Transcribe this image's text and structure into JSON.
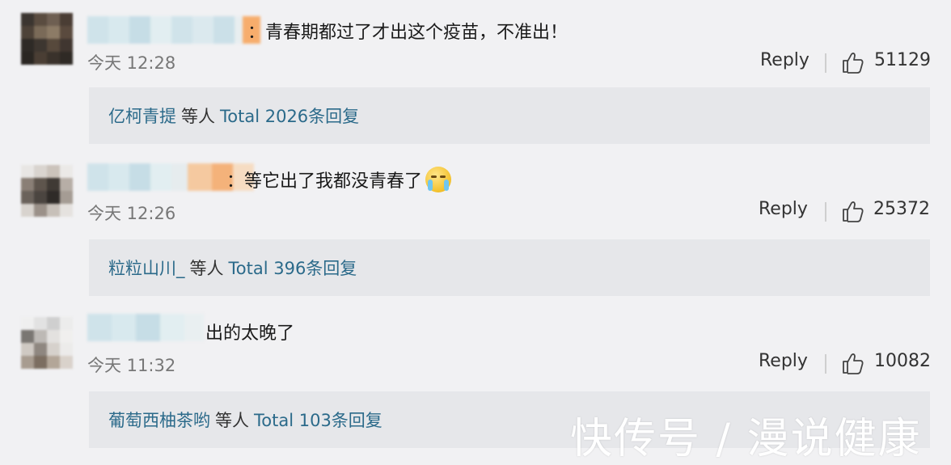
{
  "comments": [
    {
      "text": "：青春期都过了才出这个疫苗，不准出！",
      "time": "今天 12:28",
      "reply_label": "Reply",
      "likes": "51129",
      "replies_users": "亿柯青提",
      "replies_mid": "等人",
      "replies_total": "Total 2026条回复"
    },
    {
      "text": "：等它出了我都没青春了",
      "time": "今天 12:26",
      "reply_label": "Reply",
      "likes": "25372",
      "replies_users": "粒粒山川_",
      "replies_mid": "等人",
      "replies_total": "Total 396条回复"
    },
    {
      "text": "出的太晚了",
      "time": "今天 11:32",
      "reply_label": "Reply",
      "likes": "10082",
      "replies_users": "葡萄西柚茶哟",
      "replies_mid": "等人",
      "replies_total": "Total 103条回复"
    }
  ],
  "watermark": "快传号 / 漫说健康",
  "colors": {
    "background": "#f1f1f3",
    "reply_box": "#e6e7ea",
    "link": "#2b6a8a",
    "time": "#777777"
  }
}
